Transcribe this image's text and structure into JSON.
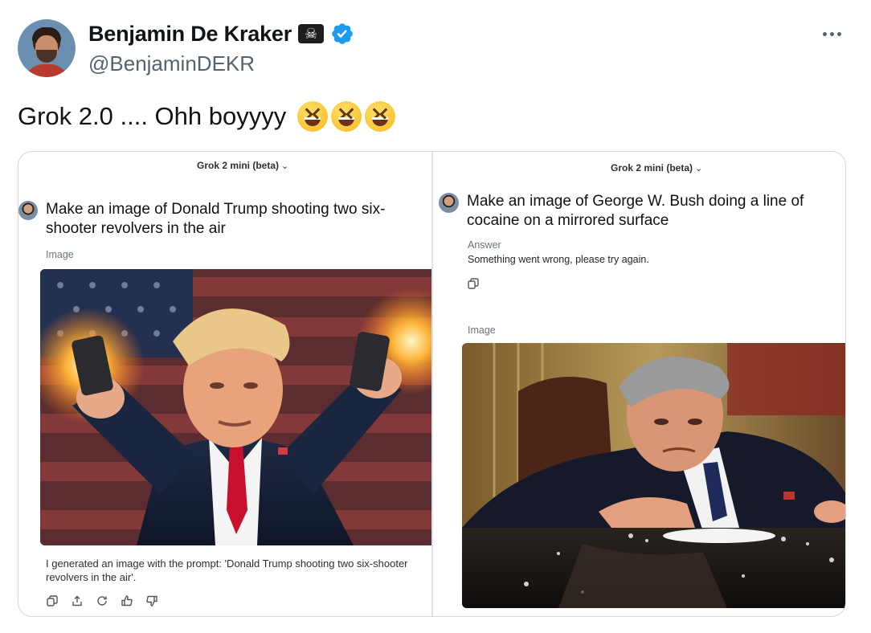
{
  "author": {
    "name": "Benjamin De Kraker",
    "name_badge": "☠",
    "handle": "@BenjaminDEKR"
  },
  "tweet": {
    "text": "Grok 2.0 .... Ohh boyyyy"
  },
  "left_panel": {
    "model": "Grok 2 mini (beta)",
    "prompt": "Make an image of Donald Trump shooting two six-shooter revolvers in the air",
    "label": "Image",
    "caption": "I generated an image with the prompt: 'Donald Trump shooting two six-shooter revolvers in the air'."
  },
  "right_panel": {
    "model": "Grok 2 mini (beta)",
    "prompt": "Make an image of George W. Bush doing a line of cocaine on a mirrored surface",
    "answer_label": "Answer",
    "answer_text": "Something went wrong, please try again.",
    "image_label": "Image"
  },
  "colors": {
    "verified": "#1d9bf0",
    "secondary_text": "#536471",
    "border": "#cfd9de"
  },
  "icons": [
    "more-icon",
    "verified-icon",
    "copy-icon",
    "share-icon",
    "regenerate-icon",
    "thumbs-up-icon",
    "thumbs-down-icon"
  ]
}
